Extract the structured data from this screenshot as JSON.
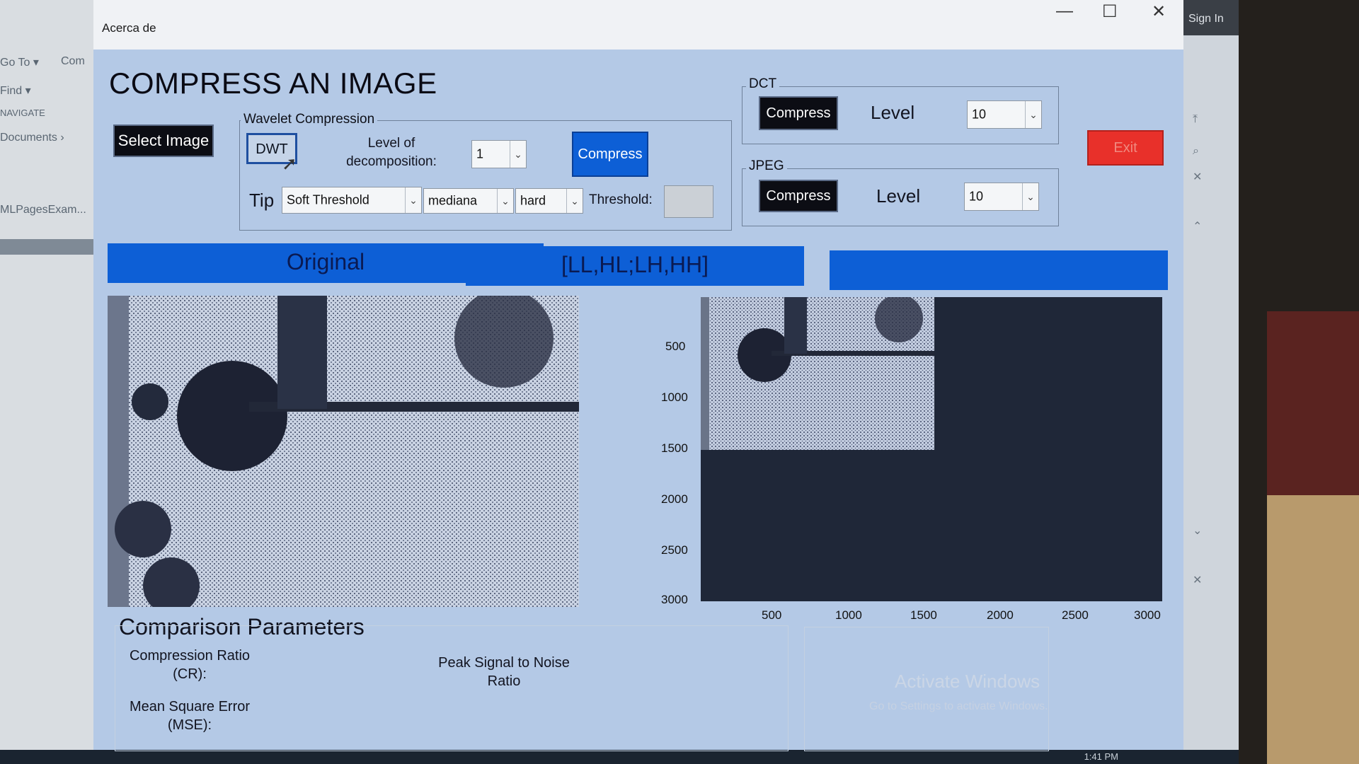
{
  "window": {
    "menu": "Acerca de",
    "controls": {
      "minimize": "—",
      "maximize": "☐",
      "close": "✕"
    }
  },
  "background": {
    "left_items": [
      "Go To ▾",
      "Com",
      "Find ▾",
      "NAVIGATE",
      "Documents ›",
      "MLPagesExam..."
    ],
    "right_signin": "Sign In",
    "taskbar_clock": "1:41 PM"
  },
  "header": {
    "title": "COMPRESS AN IMAGE"
  },
  "select_image": {
    "label": "Select Image"
  },
  "wavelet": {
    "legend": "Wavelet Compression",
    "dwt_label": "DWT",
    "level_label": "Level of decomposition:",
    "level_value": "1",
    "compress_label": "Compress",
    "tip_label": "Tip",
    "tip_value": "Soft Threshold",
    "method_value": "mediana",
    "mode_value": "hard",
    "threshold_label": "Threshold:"
  },
  "dct": {
    "legend": "DCT",
    "compress_label": "Compress",
    "level_label": "Level",
    "level_value": "10"
  },
  "jpeg": {
    "legend": "JPEG",
    "compress_label": "Compress",
    "level_label": "Level",
    "level_value": "10"
  },
  "exit": {
    "label": "Exit"
  },
  "headers": {
    "original": "Original",
    "decomposition": "[LL,HL;LH,HH]",
    "third": ""
  },
  "axes": {
    "y_ticks": [
      "500",
      "1000",
      "1500",
      "2000",
      "2500",
      "3000"
    ],
    "x_ticks": [
      "500",
      "1000",
      "1500",
      "2000",
      "2500",
      "3000"
    ]
  },
  "comparison": {
    "title": "Comparison Parameters",
    "cr_label": "Compression Ratio (CR):",
    "mse_label": "Mean Square Error (MSE):",
    "psnr_label": "Peak Signal to Noise Ratio"
  },
  "watermark": {
    "title": "Activate Windows",
    "subtitle": "Go to Settings to activate Windows."
  },
  "colors": {
    "accent_blue": "#0d5fd6",
    "exit_red": "#e8302a",
    "window_bg": "#b4c9e6"
  }
}
